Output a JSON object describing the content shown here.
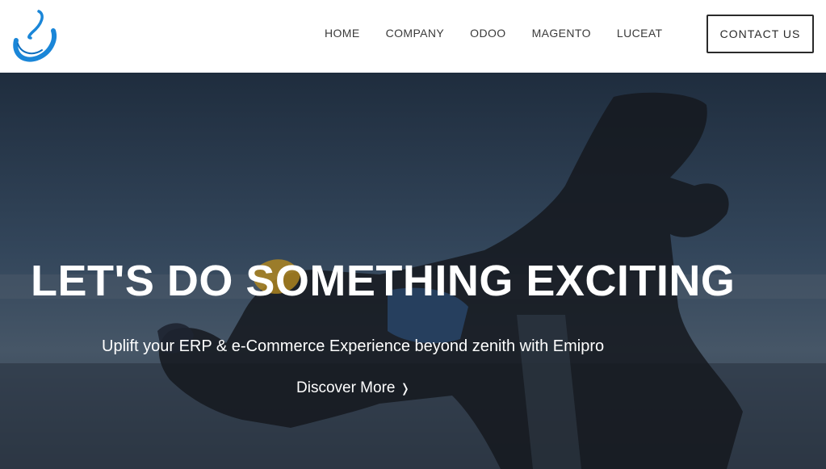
{
  "header": {
    "logo_icon": "emipro-swirl-logo",
    "brand_color": "#1a86d8",
    "nav": [
      {
        "label": "HOME"
      },
      {
        "label": "COMPANY"
      },
      {
        "label": "ODOO"
      },
      {
        "label": "MAGENTO"
      },
      {
        "label": "LUCEAT"
      }
    ],
    "contact_label": "CONTACT US"
  },
  "hero": {
    "title": "LET'S DO SOMETHING EXCITING",
    "subtitle": "Uplift your ERP & e-Commerce Experience beyond zenith with Emipro",
    "cta_label": "Discover More",
    "cta_icon": "chevron-right-icon",
    "cta_icon_glyph": "❭",
    "overlay_color": "#2c3d52"
  }
}
